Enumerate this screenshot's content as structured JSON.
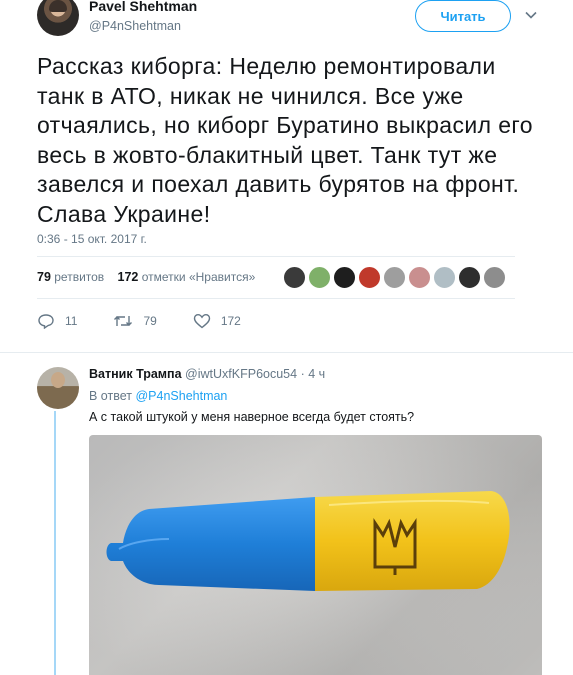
{
  "tweet": {
    "author_name": "Pavel Shehtman",
    "author_handle": "@P4nShehtman",
    "follow_label": "Читать",
    "text": "Рассказ киборга: Неделю ремонтировали танк в АТО, никак не чинился. Все уже отчаялись, но киборг Буратино выкрасил его весь в жовто-блакитный цвет. Танк тут же завелся и поехал давить бурятов на фронт. Слава Украине!",
    "timestamp": "0:36 - 15 окт. 2017 г.",
    "retweet_count": "79",
    "retweet_label": "ретвитов",
    "like_count": "172",
    "like_label": "отметки «Нравится»",
    "actions": {
      "reply_count": "11",
      "retweet_count": "79",
      "like_count": "172"
    },
    "liker_colors": [
      "#3a3a3a",
      "#7fb069",
      "#1e1e1e",
      "#c0392b",
      "#9e9e9e",
      "#c98f8f",
      "#b0bec5",
      "#2e2e2e",
      "#8d8d8d"
    ]
  },
  "reply": {
    "name": "Ватник Трампа",
    "handle": "@iwtUxfKFP6ocu54",
    "time": "4 ч",
    "reply_to_prefix": "В ответ",
    "reply_to_handle": "@P4nShehtman",
    "text": "А с такой штукой  у меня наверное всегда будет стоять?"
  },
  "colors": {
    "accent": "#1da1f2",
    "muted": "#657786",
    "flag_blue": "#1f7fd8",
    "flag_yellow": "#f2c21a"
  }
}
